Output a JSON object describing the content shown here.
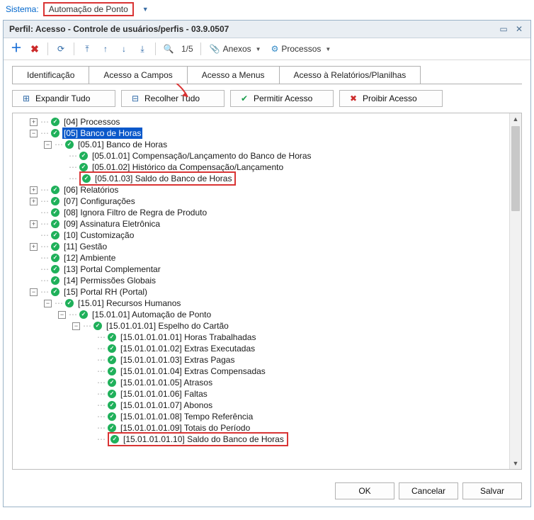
{
  "top": {
    "sys_label": "Sistema:",
    "sys_value": "Automação de Ponto"
  },
  "window": {
    "title": "Perfil: Acesso - Controle de usuários/perfis - 03.9.0507"
  },
  "toolbar": {
    "page": "1/5",
    "anexos": "Anexos",
    "processos": "Processos"
  },
  "tabs": {
    "t1": "Identificação",
    "t2": "Acesso a Campos",
    "t3": "Acesso a Menus",
    "t4": "Acesso à Relatórios/Planilhas"
  },
  "actions": {
    "expand": "Expandir Tudo",
    "collapse": "Recolher Tudo",
    "allow": "Permitir Acesso",
    "deny": "Proibir Acesso"
  },
  "tree": {
    "n04": "[04] Processos",
    "n05": "[05] Banco de Horas",
    "n0501": "[05.01] Banco de Horas",
    "n050101": "[05.01.01] Compensação/Lançamento do Banco de Horas",
    "n050102": "[05.01.02] Histórico da Compensação/Lançamento",
    "n050103": "[05.01.03] Saldo do Banco de Horas",
    "n06": "[06] Relatórios",
    "n07": "[07] Configurações",
    "n08": "[08] Ignora Filtro de Regra de Produto",
    "n09": "[09] Assinatura Eletrônica",
    "n10": "[10] Customização",
    "n11": "[11] Gestão",
    "n12": "[12] Ambiente",
    "n13": "[13] Portal Complementar",
    "n14": "[14] Permissões Globais",
    "n15": "[15] Portal RH (Portal)",
    "n1501": "[15.01] Recursos Humanos",
    "n150101": "[15.01.01] Automação de Ponto",
    "n15010101": "[15.01.01.01] Espelho do Cartão",
    "l01": "[15.01.01.01.01] Horas Trabalhadas",
    "l02": "[15.01.01.01.02] Extras Executadas",
    "l03": "[15.01.01.01.03] Extras Pagas",
    "l04": "[15.01.01.01.04] Extras Compensadas",
    "l05": "[15.01.01.01.05] Atrasos",
    "l06": "[15.01.01.01.06] Faltas",
    "l07": "[15.01.01.01.07] Abonos",
    "l08": "[15.01.01.01.08] Tempo Referência",
    "l09": "[15.01.01.01.09] Totais do Período",
    "l10": "[15.01.01.01.10] Saldo do Banco de Horas"
  },
  "footer": {
    "ok": "OK",
    "cancel": "Cancelar",
    "save": "Salvar"
  }
}
